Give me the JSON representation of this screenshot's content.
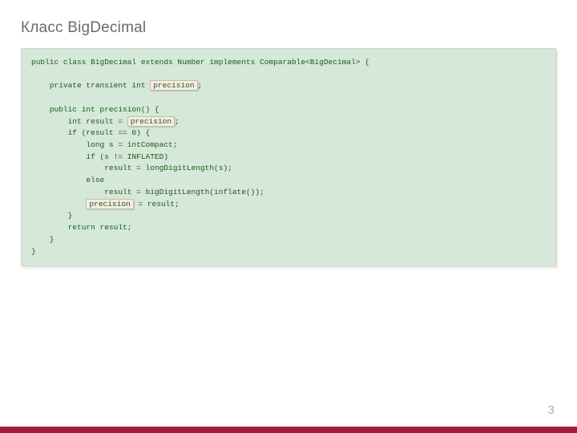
{
  "title": "Класс BigDecimal",
  "code": {
    "l1": "public class BigDecimal extends Number implements Comparable<BigDecimal> {",
    "l2a": "    private transient int ",
    "hl1": "precision",
    "l2b": ";",
    "l3": "    public int precision() {",
    "l4a": "        int result = ",
    "hl2": "precision",
    "l4b": ";",
    "l5": "        if (result == 0) {",
    "l6": "            long s = intCompact;",
    "l7": "            if (s != INFLATED)",
    "l8": "                result = longDigitLength(s);",
    "l9": "            else",
    "l10": "                result = bigDigitLength(inflate());",
    "l11a": "            ",
    "hl3": "precision",
    "l11b": " = result;",
    "l12": "        }",
    "l13": "        return result;",
    "l14": "    }",
    "l15": "}"
  },
  "page_number": "3"
}
